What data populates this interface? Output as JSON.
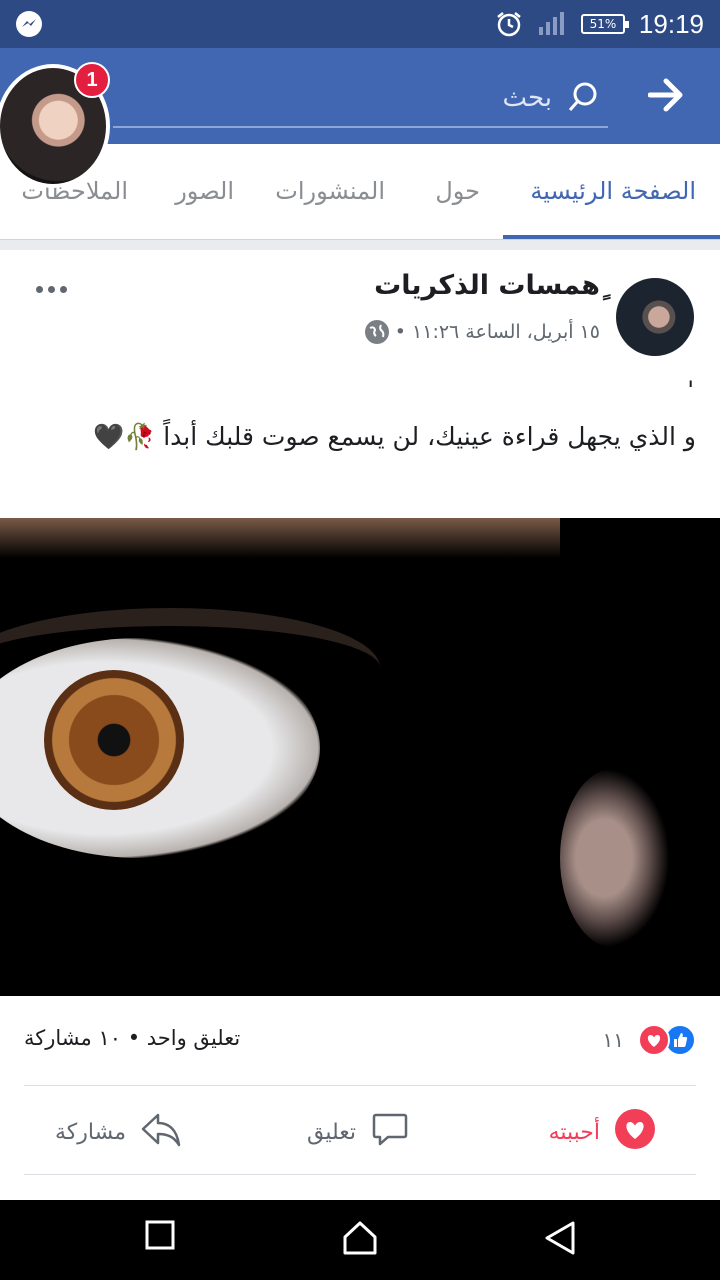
{
  "status_bar": {
    "time": "19:19",
    "battery": "51%"
  },
  "header": {
    "search_placeholder": "بحث",
    "notification_count": "1"
  },
  "tabs": [
    {
      "label": "الصفحة الرئيسية",
      "active": true
    },
    {
      "label": "حول",
      "active": false
    },
    {
      "label": "المنشورات",
      "active": false
    },
    {
      "label": "الصور",
      "active": false
    },
    {
      "label": "الملاحظات",
      "active": false
    }
  ],
  "post": {
    "page_name": "ٍهمسات الذكريات",
    "meta": "١٥ أبريل، الساعة ١١:٢٦ •",
    "quote_mark": "'",
    "text": "و الذي يجهل قراءة عينيك، لن يسمع صوت قلبك أبداً 🥀🖤",
    "reaction_count": "١١",
    "comments_shares": "تعليق واحد • ١٠ مشاركة",
    "actions": {
      "love": "أحببته",
      "comment": "تعليق",
      "share": "مشاركة"
    }
  },
  "icons": {
    "messenger": "messenger-icon",
    "alarm": "alarm-icon",
    "signal": "signal-icon",
    "back": "arrow-right-icon",
    "search": "search-icon",
    "globe": "globe-icon",
    "more": "more-dots-icon"
  },
  "colors": {
    "brand": "#4267b2",
    "status_bar": "#2e4a84",
    "love": "#f33e58",
    "like": "#1877f2"
  }
}
